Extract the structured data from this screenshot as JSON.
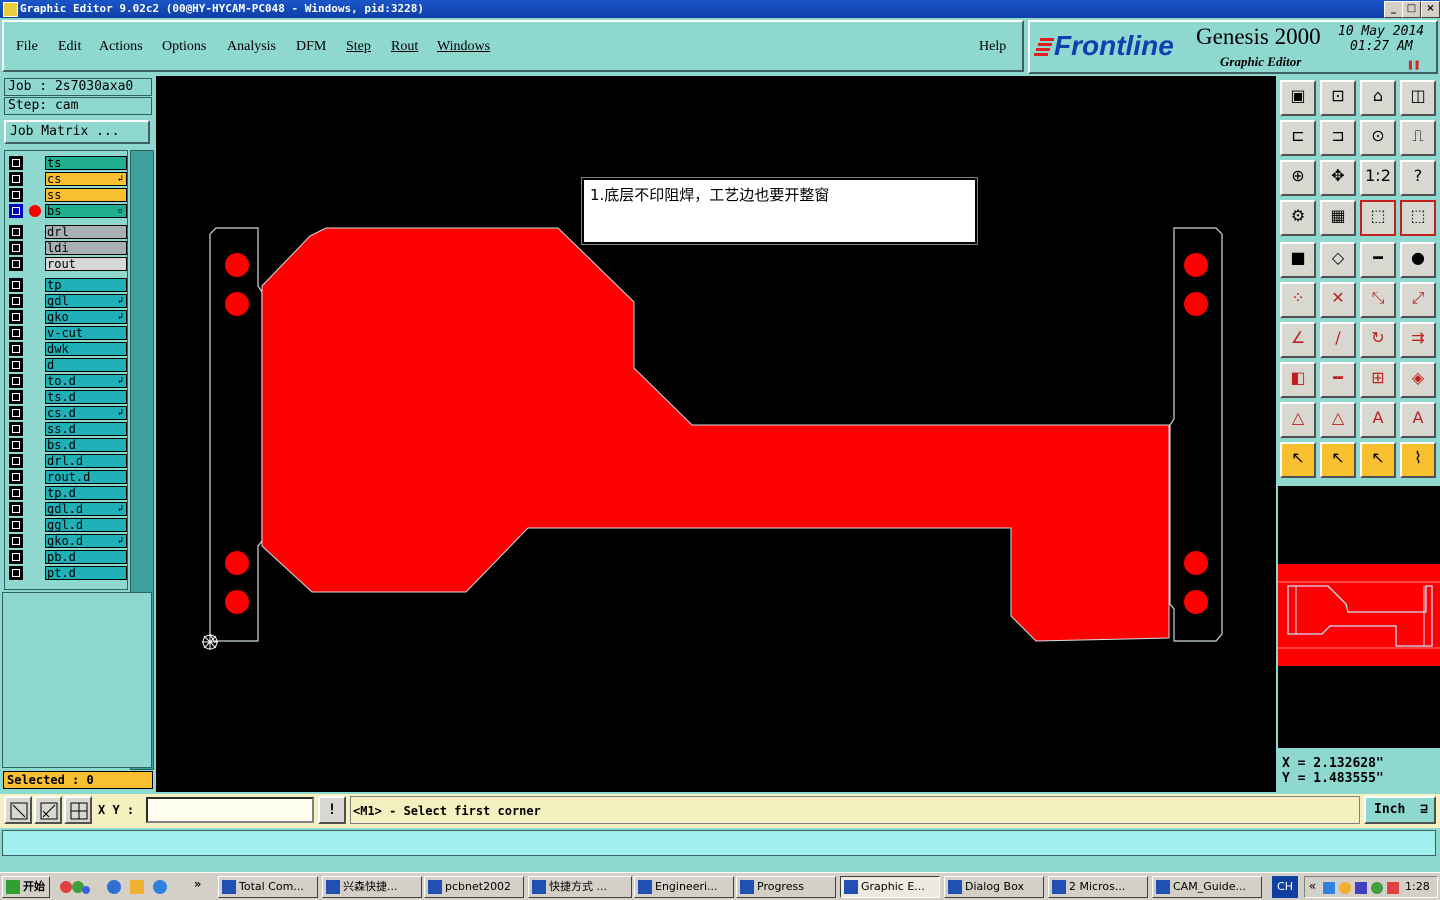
{
  "window": {
    "title": "Graphic Editor 9.02c2 (00@HY-HYCAM-PC048 - Windows, pid:3228)"
  },
  "menu": {
    "file": "File",
    "edit": "Edit",
    "actions": "Actions",
    "options": "Options",
    "analysis": "Analysis",
    "dfm": "DFM",
    "step": "Step",
    "rout": "Rout",
    "windows": "Windows",
    "help": "Help"
  },
  "brand": {
    "logo": "Frontline",
    "product": "Genesis 2000",
    "subtitle": "Graphic Editor",
    "date": "10 May 2014",
    "time": "01:27 AM"
  },
  "job": {
    "job_line": "Job : 2s7030axa0",
    "step_line": "Step: cam",
    "matrix_button": "Job Matrix ..."
  },
  "layers": [
    {
      "name": "ts",
      "color": "#20b090"
    },
    {
      "name": "cs",
      "color": "#f8c030",
      "mark": "↲"
    },
    {
      "name": "ss",
      "color": "#f8c030"
    },
    {
      "name": "bs",
      "color": "#20b090",
      "mark": "▫",
      "active": true
    },
    {
      "name": "drl",
      "color": "#a8b0b0"
    },
    {
      "name": "ldi",
      "color": "#a8b0b0"
    },
    {
      "name": "rout",
      "color": "#d8d8d8"
    },
    {
      "name": "tp",
      "color": "#20b0b8"
    },
    {
      "name": "gdl",
      "color": "#20b0b8",
      "mark": "↲"
    },
    {
      "name": "gko",
      "color": "#20b0b8",
      "mark": "↲"
    },
    {
      "name": "v-cut",
      "color": "#20b0b8"
    },
    {
      "name": "dwk",
      "color": "#20b0b8"
    },
    {
      "name": "d",
      "color": "#20b0b8"
    },
    {
      "name": "to.d",
      "color": "#20b0b8",
      "mark": "↲"
    },
    {
      "name": "ts.d",
      "color": "#20b0b8"
    },
    {
      "name": "cs.d",
      "color": "#20b0b8",
      "mark": "↲"
    },
    {
      "name": "ss.d",
      "color": "#20b0b8"
    },
    {
      "name": "bs.d",
      "color": "#20b0b8"
    },
    {
      "name": "drl.d",
      "color": "#20b0b8"
    },
    {
      "name": "rout.d",
      "color": "#20b0b8"
    },
    {
      "name": "tp.d",
      "color": "#20b0b8"
    },
    {
      "name": "gdl.d",
      "color": "#20b0b8",
      "mark": "↲"
    },
    {
      "name": "ggl.d",
      "color": "#20b0b8"
    },
    {
      "name": "gko.d",
      "color": "#20b0b8",
      "mark": "↲"
    },
    {
      "name": "pb.d",
      "color": "#20b0b8"
    },
    {
      "name": "pt.d",
      "color": "#20b0b8"
    }
  ],
  "selected": {
    "label": "Selected : 0"
  },
  "note": {
    "text": "1.底层不印阻焊，工艺边也要开整窗"
  },
  "coords": {
    "x": "X = 2.132628\"",
    "y": "Y = 1.483555\""
  },
  "command": {
    "xy_label": "X Y :",
    "input_value": "",
    "prompt": "<M1> - Select first corner",
    "units": "Inch"
  },
  "taskbar": {
    "start": "开始",
    "items": [
      "Total Com...",
      "兴森快捷...",
      "pcbnet2002",
      "快捷方式 ...",
      "Engineeri...",
      "Progress",
      "Graphic E...",
      "Dialog Box",
      "2 Micros...",
      "CAM_Guide..."
    ],
    "lang": "CH",
    "clock": "1:28"
  },
  "colors": {
    "copper": "#ff0000",
    "canvas": "#000000",
    "panel": "#8fd8d0"
  }
}
